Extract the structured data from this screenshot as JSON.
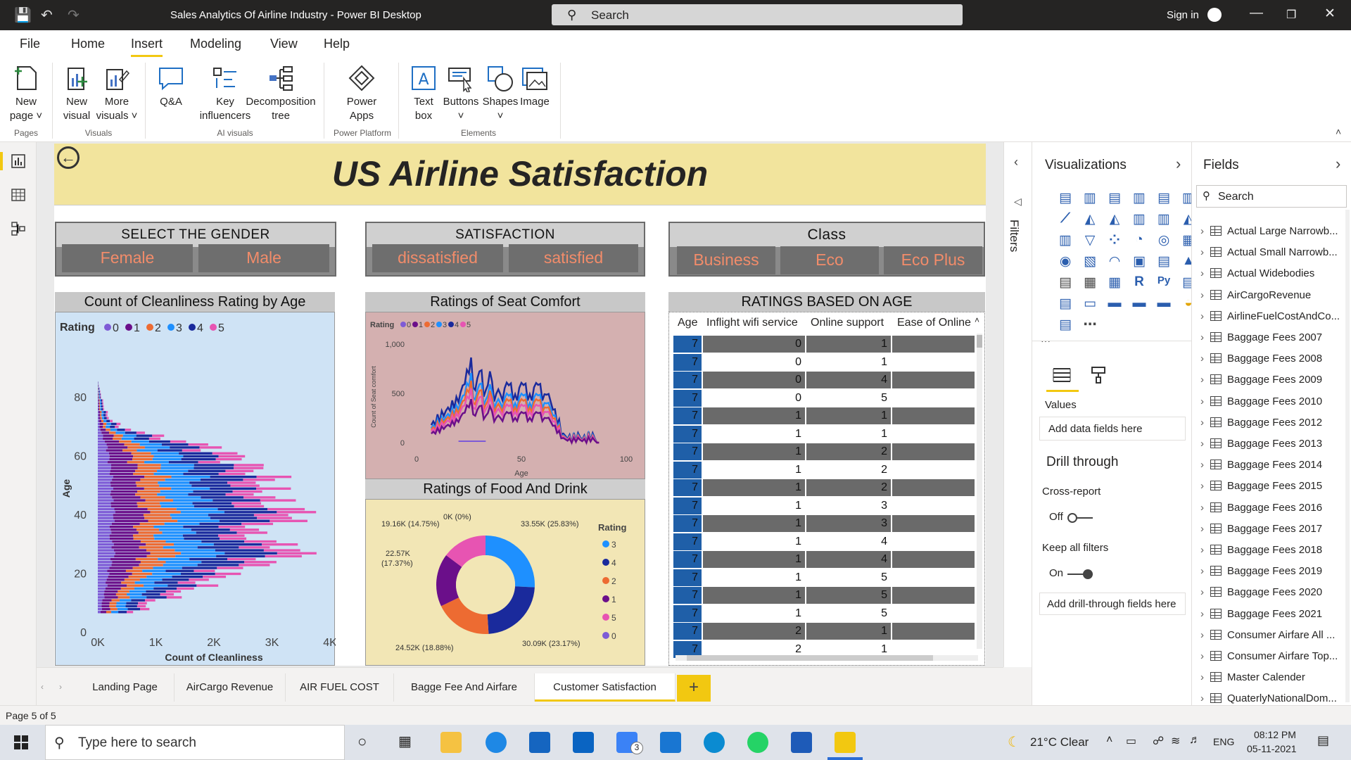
{
  "window": {
    "title": "Sales Analytics Of Airline Industry - Power BI Desktop",
    "search_placeholder": "Search",
    "sign_in": "Sign in"
  },
  "menu": {
    "items": [
      "File",
      "Home",
      "Insert",
      "Modeling",
      "View",
      "Help"
    ],
    "active": "Insert"
  },
  "ribbon": {
    "buttons": {
      "new_page": "New",
      "new_page2": "page",
      "new_visual": "New",
      "new_visual2": "visual",
      "more_visuals": "More",
      "more_visuals2": "visuals",
      "qa": "Q&A",
      "key_inf": "Key",
      "key_inf2": "influencers",
      "decomp": "Decomposition",
      "decomp2": "tree",
      "power_apps": "Power",
      "power_apps2": "Apps",
      "text_box": "Text",
      "text_box2": "box",
      "buttons": "Buttons",
      "shapes": "Shapes",
      "image": "Image"
    },
    "groups": {
      "pages": "Pages",
      "visuals": "Visuals",
      "ai_visuals": "AI visuals",
      "power_platform": "Power Platform",
      "elements": "Elements"
    }
  },
  "report": {
    "title": "US Airline Satisfaction",
    "gender": {
      "header": "SELECT THE GENDER",
      "options": [
        "Female",
        "Male"
      ]
    },
    "satisfaction": {
      "header": "SATISFACTION",
      "options": [
        "dissatisfied",
        "satisfied"
      ]
    },
    "class": {
      "header": "Class",
      "options": [
        "Business",
        "Eco",
        "Eco Plus"
      ]
    },
    "cleanliness": {
      "title": "Count of Cleanliness Rating by Age",
      "legend_title": "Rating",
      "legend": [
        "0",
        "1",
        "2",
        "3",
        "4",
        "5"
      ],
      "xlabel": "Count of Cleanliness",
      "ylabel": "Age",
      "xticks": [
        "0K",
        "1K",
        "2K",
        "3K",
        "4K"
      ],
      "yticks": [
        "0",
        "20",
        "40",
        "60",
        "80"
      ]
    },
    "seat": {
      "title": "Ratings of Seat Comfort",
      "legend_title": "Rating",
      "legend": [
        "0",
        "1",
        "2",
        "3",
        "4",
        "5"
      ],
      "ylabel": "Count of Seat comfort",
      "xlabel": "Age",
      "xticks": [
        "0",
        "50",
        "100"
      ],
      "yticks": [
        "0",
        "500",
        "1,000"
      ]
    },
    "food": {
      "title": "Ratings of Food And Drink",
      "legend_title": "Rating",
      "legend": [
        "3",
        "4",
        "2",
        "1",
        "5",
        "0"
      ],
      "labels": {
        "l3": "33.55K (25.83%)",
        "l4": "30.09K (23.17%)",
        "l2": "24.52K (18.88%)",
        "l1a": "22.57K",
        "l1b": "(17.37%)",
        "l5": "19.16K (14.75%)",
        "l0": "0K (0%)"
      }
    },
    "table": {
      "title": "RATINGS BASED ON AGE",
      "columns": [
        "Age",
        "Inflight wifi service",
        "Online support",
        "Ease of Online b"
      ],
      "rows": [
        [
          "7",
          "0",
          "1"
        ],
        [
          "7",
          "0",
          "1"
        ],
        [
          "7",
          "0",
          "4"
        ],
        [
          "7",
          "0",
          "5"
        ],
        [
          "7",
          "1",
          "1"
        ],
        [
          "7",
          "1",
          "1"
        ],
        [
          "7",
          "1",
          "2"
        ],
        [
          "7",
          "1",
          "2"
        ],
        [
          "7",
          "1",
          "2"
        ],
        [
          "7",
          "1",
          "3"
        ],
        [
          "7",
          "1",
          "3"
        ],
        [
          "7",
          "1",
          "4"
        ],
        [
          "7",
          "1",
          "4"
        ],
        [
          "7",
          "1",
          "5"
        ],
        [
          "7",
          "1",
          "5"
        ],
        [
          "7",
          "1",
          "5"
        ],
        [
          "7",
          "2",
          "1"
        ],
        [
          "7",
          "2",
          "1"
        ]
      ]
    }
  },
  "chart_data": [
    {
      "type": "bar",
      "title": "Count of Cleanliness Rating by Age",
      "orientation": "horizontal-stacked",
      "xlabel": "Count of Cleanliness",
      "ylabel": "Age",
      "xlim": [
        0,
        4000
      ],
      "ylim": [
        0,
        85
      ],
      "series": [
        {
          "name": "0",
          "values": []
        },
        {
          "name": "1",
          "values": []
        },
        {
          "name": "2",
          "values": []
        },
        {
          "name": "3",
          "values": []
        },
        {
          "name": "4",
          "values": []
        },
        {
          "name": "5",
          "values": []
        }
      ],
      "profile": {
        "age": [
          7,
          10,
          13,
          16,
          19,
          22,
          25,
          28,
          31,
          34,
          37,
          40,
          43,
          46,
          49,
          52,
          55,
          58,
          61,
          64,
          67,
          70,
          73,
          76,
          79,
          82,
          85
        ],
        "total": [
          700,
          900,
          1400,
          1800,
          2100,
          2500,
          3200,
          3600,
          2900,
          2600,
          3000,
          3700,
          3100,
          3000,
          2900,
          3000,
          2800,
          2500,
          2300,
          1800,
          1000,
          400,
          200,
          120,
          80,
          40,
          10
        ]
      }
    },
    {
      "type": "line",
      "title": "Ratings of Seat Comfort",
      "xlabel": "Age",
      "ylabel": "Count of Seat comfort",
      "xlim": [
        0,
        100
      ],
      "ylim": [
        0,
        1000
      ],
      "series": [
        {
          "name": "4",
          "peak": 880
        },
        {
          "name": "3",
          "peak": 720
        },
        {
          "name": "2",
          "peak": 640
        },
        {
          "name": "5",
          "peak": 560
        },
        {
          "name": "1",
          "peak": 450
        },
        {
          "name": "0",
          "peak": 0
        }
      ]
    },
    {
      "type": "pie",
      "title": "Ratings of Food And Drink",
      "donut": true,
      "slices": [
        {
          "name": "3",
          "value": 33550,
          "pct": 25.83
        },
        {
          "name": "4",
          "value": 30090,
          "pct": 23.17
        },
        {
          "name": "2",
          "value": 24520,
          "pct": 18.88
        },
        {
          "name": "1",
          "value": 22570,
          "pct": 17.37
        },
        {
          "name": "5",
          "value": 19160,
          "pct": 14.75
        },
        {
          "name": "0",
          "value": 0,
          "pct": 0
        }
      ]
    }
  ],
  "colors": {
    "r0": "#7e5bd6",
    "r1": "#6b0f8a",
    "r2": "#ed6b32",
    "r3": "#1e90ff",
    "r4": "#1a2a9c",
    "r5": "#e754b2",
    "banner": "#f2e49d",
    "accent": "#f2c811"
  },
  "visualizations": {
    "title": "Visualizations",
    "values_label": "Values",
    "add_fields": "Add data fields here",
    "drill_through": "Drill through",
    "cross_report": "Cross-report",
    "off": "Off",
    "keep_filters": "Keep all filters",
    "on": "On",
    "add_drill": "Add drill-through fields here"
  },
  "filters_label": "Filters",
  "fields": {
    "title": "Fields",
    "search": "Search",
    "items": [
      "Actual Large Narrowb...",
      "Actual Small Narrowb...",
      "Actual Widebodies",
      "AirCargoRevenue",
      "AirlineFuelCostAndCo...",
      "Baggage Fees 2007",
      "Baggage Fees 2008",
      "Baggage Fees 2009",
      "Baggage Fees 2010",
      "Baggage Fees 2012",
      "Baggage Fees 2013",
      "Baggage Fees 2014",
      "Baggage Fees 2015",
      "Baggage Fees 2016",
      "Baggage Fees 2017",
      "Baggage Fees 2018",
      "Baggage Fees 2019",
      "Baggage Fees 2020",
      "Baggage Fees 2021",
      "Consumer Airfare All ...",
      "Consumer Airfare Top...",
      "Master Calender",
      "QuaterlyNationalDom..."
    ]
  },
  "pages": {
    "tabs": [
      "Landing Page",
      "AirCargo Revenue",
      "AIR FUEL COST",
      "Bagge Fee And Airfare",
      "Customer Satisfaction"
    ],
    "active": "Customer Satisfaction",
    "status": "Page 5 of 5"
  },
  "taskbar": {
    "search": "Type here to search",
    "weather": "21°C  Clear",
    "lang": "ENG",
    "time": "08:12 PM",
    "date": "05-11-2021",
    "badge": "3"
  }
}
